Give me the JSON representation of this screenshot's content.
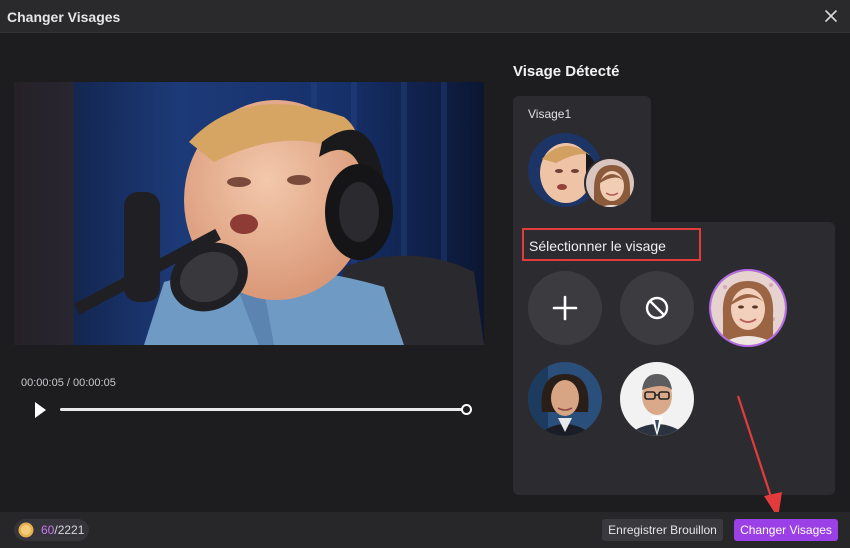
{
  "window": {
    "title": "Changer Visages"
  },
  "player": {
    "time": "00:00:05 / 00:00:05",
    "progress": 1.0
  },
  "detected": {
    "heading": "Visage Détecté",
    "tab_label": "Visage1"
  },
  "selection": {
    "label": "Sélectionner le visage"
  },
  "footer": {
    "credits_used": "60",
    "credits_total": "/2221",
    "draft_button": "Enregistrer Brouillon",
    "swap_button": "Changer Visages"
  },
  "colors": {
    "accent": "#9b3fe6",
    "highlight": "#e23b3b",
    "background": "#1d1d20",
    "panel": "#2c2c30"
  },
  "icons": [
    "close-icon",
    "play-icon",
    "plus-icon",
    "no-icon",
    "coin-icon"
  ]
}
